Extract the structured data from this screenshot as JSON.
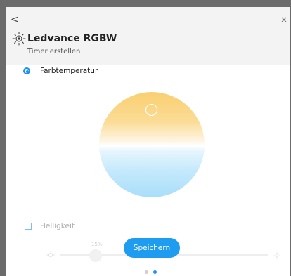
{
  "header": {
    "back_glyph": "<",
    "close_glyph": "×",
    "device_icon": "light-bulb-icon",
    "title": "Ledvance RGBW",
    "subtitle": "Timer erstellen"
  },
  "color_temperature": {
    "label": "Farbtemperatur",
    "selected": true,
    "warm_color": "#f9cf70",
    "cool_color": "#a9def9"
  },
  "brightness": {
    "label": "Helligkeit",
    "checked": false,
    "value_label": "15%",
    "level": 0.15
  },
  "actions": {
    "save_label": "Speichern",
    "save_color": "#1d9cf0"
  },
  "pagination": {
    "total": 2,
    "active": 2,
    "active_color": "#1d8ff0"
  }
}
